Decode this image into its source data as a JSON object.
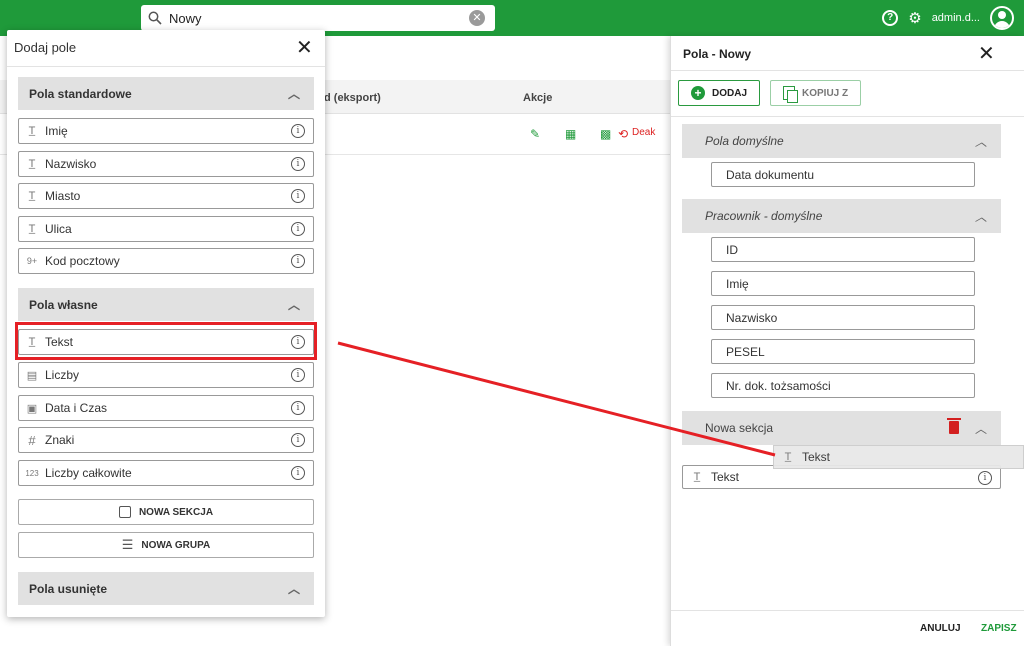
{
  "header": {
    "search_value": "Nowy",
    "user_name": "admin.d...",
    "help_glyph": "?",
    "accent": "#1f9a3a"
  },
  "background": {
    "columns": [
      "d (eksport)",
      "Akcje"
    ],
    "deactivate_label": "Deak"
  },
  "left_dialog": {
    "title": "Dodaj pole",
    "sections": {
      "standard": "Pola standardowe",
      "custom": "Pola własne",
      "deleted": "Pola usunięte"
    },
    "standard_fields": [
      "Imię",
      "Nazwisko",
      "Miasto",
      "Ulica",
      "Kod pocztowy"
    ],
    "custom_fields": [
      "Tekst",
      "Liczby",
      "Data i Czas",
      "Znaki",
      "Liczby całkowite"
    ],
    "new_section_label": "NOWA SEKCJA",
    "new_group_label": "NOWA GRUPA"
  },
  "right_panel": {
    "title": "Pola - Nowy",
    "add_label": "DODAJ",
    "copy_label": "KOPIUJ Z",
    "sections": {
      "default": "Pola domyślne",
      "employee": "Pracownik - domyślne",
      "new": "Nowa sekcja"
    },
    "default_fields": [
      "Data dokumentu"
    ],
    "employee_fields": [
      "ID",
      "Imię",
      "Nazwisko",
      "PESEL",
      "Nr. dok. tożsamości"
    ],
    "dragged_label": "Tekst",
    "dropped_label": "Tekst",
    "cancel_label": "ANULUJ",
    "save_label": "ZAPISZ"
  }
}
